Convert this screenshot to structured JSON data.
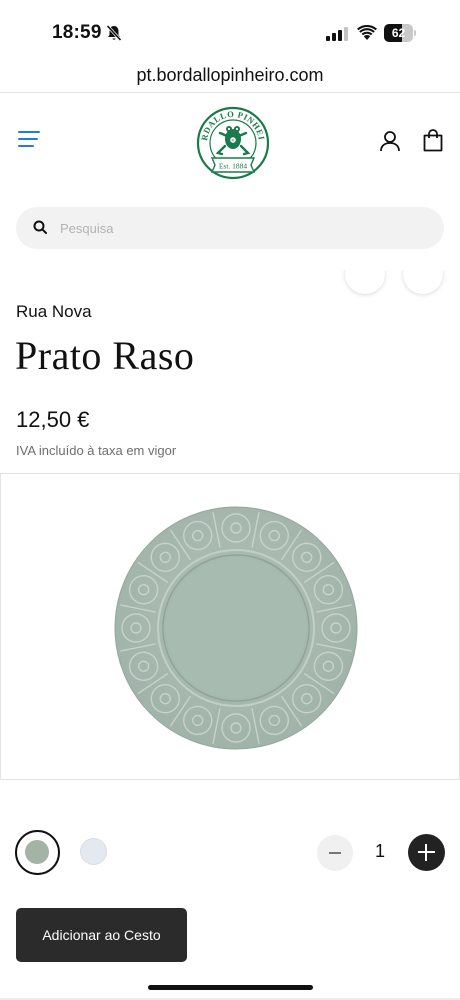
{
  "status_bar": {
    "time": "18:59",
    "battery_level": "62",
    "battery_fraction": 0.62
  },
  "browser": {
    "url": "pt.bordallopinheiro.com"
  },
  "header": {
    "menu_icon": "hamburger-menu-icon",
    "logo_text_top": "BORDALLO PINHEIRO",
    "logo_text_bottom": "Est. 1884",
    "account_icon": "user-icon",
    "cart_icon": "shopping-bag-icon",
    "brand_color": "#1a7a4c",
    "accent_color": "#1f7fd6"
  },
  "search": {
    "placeholder": "Pesquisa",
    "value": ""
  },
  "product": {
    "collection": "Rua Nova",
    "title": "Prato Raso",
    "price": "12,50 €",
    "tax_note": "IVA incluído à taxa em vigor",
    "plate_color": "#a9bbb0"
  },
  "variants": [
    {
      "color": "#a3b3a6",
      "selected": true
    },
    {
      "color": "#e4e9ef",
      "selected": false
    }
  ],
  "quantity": {
    "value": "1"
  },
  "actions": {
    "add_to_cart_label": "Adicionar ao Cesto"
  }
}
